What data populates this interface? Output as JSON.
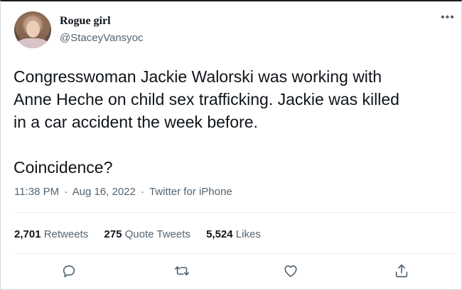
{
  "author": {
    "display_name": "Rogue girl",
    "handle": "@StaceyVansyoc"
  },
  "menu_icon": "more-horizontal-icon",
  "tweet": {
    "text": "Congresswoman Jackie Walorski was working with\nAnne Heche on child sex trafficking. Jackie was killed\nin a car accident the week before.\n\nCoincidence?",
    "time": "11:38 PM",
    "date": "Aug 16, 2022",
    "source": "Twitter for iPhone",
    "separator": "·"
  },
  "stats": {
    "retweets_count": "2,701",
    "retweets_label": "Retweets",
    "quotes_count": "275",
    "quotes_label": "Quote Tweets",
    "likes_count": "5,524",
    "likes_label": "Likes"
  },
  "actions": [
    {
      "icon": "reply-icon"
    },
    {
      "icon": "retweet-icon"
    },
    {
      "icon": "like-icon"
    },
    {
      "icon": "share-icon"
    }
  ],
  "colors": {
    "text": "#0f1419",
    "secondary": "#536471",
    "border": "#cfd9de"
  }
}
